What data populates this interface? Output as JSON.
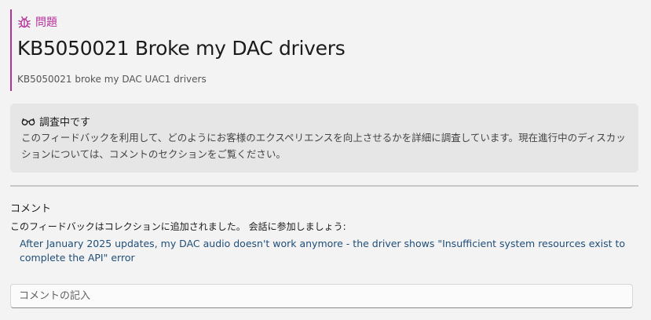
{
  "issue": {
    "type_label": "問題",
    "type_icon": "bug-icon",
    "accent_color": "#b4309a",
    "title": "KB5050021 Broke my DAC drivers",
    "subtitle": "KB5050021 broke my DAC UAC1 drivers"
  },
  "status": {
    "icon": "glasses-icon",
    "title": "調査中です",
    "description": "このフィードバックを利用して、どのようにお客様のエクスペリエンスを向上させるかを詳細に調査しています。現在進行中のディスカッションについては、コメントのセクションをご覧ください。"
  },
  "comments": {
    "heading": "コメント",
    "collection_note": "このフィードバックはコレクションに追加されました。 会話に参加しましょう:",
    "linked_item": "After January 2025 updates, my DAC audio doesn't work anymore - the driver shows \"Insufficient system resources exist to complete the API\" error",
    "input_placeholder": "コメントの記入",
    "input_value": ""
  }
}
